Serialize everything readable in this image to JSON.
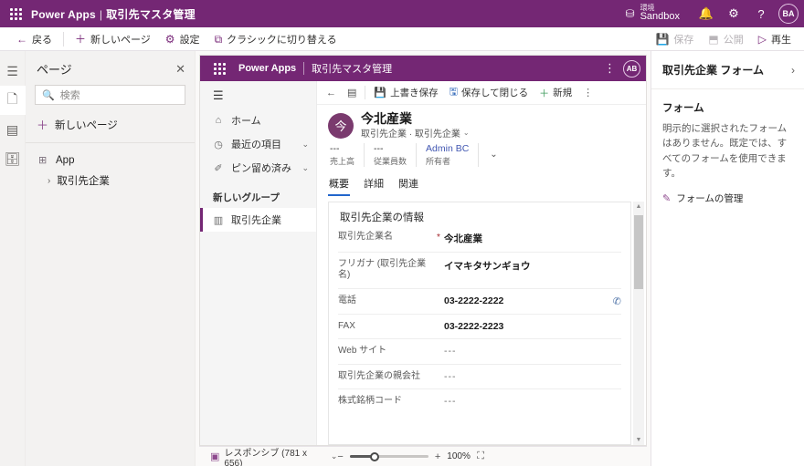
{
  "topbar": {
    "brand": "Power Apps",
    "separator": "|",
    "app_name": "取引先マスタ管理",
    "env_label": "環境",
    "env_name": "Sandbox",
    "notification_icon": "🔔",
    "settings_icon": "⚙",
    "help_icon": "?",
    "avatar_initials": "BA"
  },
  "toolbar": {
    "back": "戻る",
    "new_page": "新しいページ",
    "settings": "設定",
    "switch_classic": "クラシックに切り替える",
    "save": "保存",
    "publish": "公開",
    "play": "再生"
  },
  "rail": {
    "tree_view": "tree-view",
    "pages": "pages",
    "navigation": "navigation",
    "data": "data"
  },
  "pages_panel": {
    "title": "ページ",
    "close": "✕",
    "search_placeholder": "検索",
    "new_page": "新しいページ",
    "tree": [
      {
        "label": "App",
        "icon": "⊞",
        "chevron": ""
      },
      {
        "label": "取引先企業",
        "icon": "",
        "chevron": "›"
      }
    ]
  },
  "preview": {
    "header": {
      "brand": "Power Apps",
      "app_name": "取引先マスタ管理",
      "overflow": "⋮",
      "avatar_initials": "AB"
    },
    "sitemap": {
      "items": [
        {
          "label": "ホーム",
          "icon": "⌂",
          "chevron": ""
        },
        {
          "label": "最近の項目",
          "icon": "◷",
          "chevron": "⌄"
        },
        {
          "label": "ピン留め済み",
          "icon": "✐",
          "chevron": "⌄"
        }
      ],
      "group_title": "新しいグループ",
      "selected_item": "取引先企業"
    },
    "commandbar": {
      "back": "←",
      "panel": "▤",
      "save": "上書き保存",
      "save_close": "保存して閉じる",
      "new": "新規",
      "overflow": "⋮"
    },
    "record": {
      "avatar_glyph": "今",
      "title": "今北産業",
      "subtitle": "取引先企業 · 取引先企業",
      "subtitle_chevron": "⌄",
      "stats": [
        {
          "value": "---",
          "label": "売上高"
        },
        {
          "value": "---",
          "label": "従業員数"
        },
        {
          "value": "Admin BC",
          "label": "所有者",
          "is_link": true
        }
      ],
      "stats_chevron": "⌄"
    },
    "tabs": [
      {
        "label": "概要",
        "active": true
      },
      {
        "label": "詳細",
        "active": false
      },
      {
        "label": "関連",
        "active": false
      }
    ],
    "form": {
      "legend": "取引先企業の情報",
      "fields": [
        {
          "label": "取引先企業名",
          "required": "*",
          "value": "今北産業",
          "action": ""
        },
        {
          "label": "フリガナ (取引先企業名)",
          "required": "",
          "value": "イマキタサンギョウ",
          "action": ""
        },
        {
          "label": "電話",
          "required": "",
          "value": "03-2222-2222",
          "action": "✆"
        },
        {
          "label": "FAX",
          "required": "",
          "value": "03-2222-2223",
          "action": ""
        },
        {
          "label": "Web サイト",
          "required": "",
          "value": "---",
          "action": ""
        },
        {
          "label": "取引先企業の親会社",
          "required": "",
          "value": "---",
          "action": ""
        },
        {
          "label": "株式銘柄コード",
          "required": "",
          "value": "---",
          "action": ""
        }
      ]
    },
    "scrollbar": {
      "up": "▲",
      "down": "▼"
    }
  },
  "properties": {
    "title": "取引先企業 フォーム",
    "collapse": "›",
    "section": "フォーム",
    "description": "明示的に選択されたフォームはありません。既定では、すべてのフォームを使用できます。",
    "manage_link": "フォームの管理"
  },
  "statusbar": {
    "layout": "レスポンシブ (781 x 656)",
    "layout_chevron": "⌄",
    "zoom_out": "−",
    "zoom_in": "+",
    "zoom_level": "100%",
    "fit_icon": "⛶"
  },
  "colors": {
    "brand_purple": "#742774",
    "accent_blue": "#2266cc",
    "required_red": "#a4262c"
  }
}
